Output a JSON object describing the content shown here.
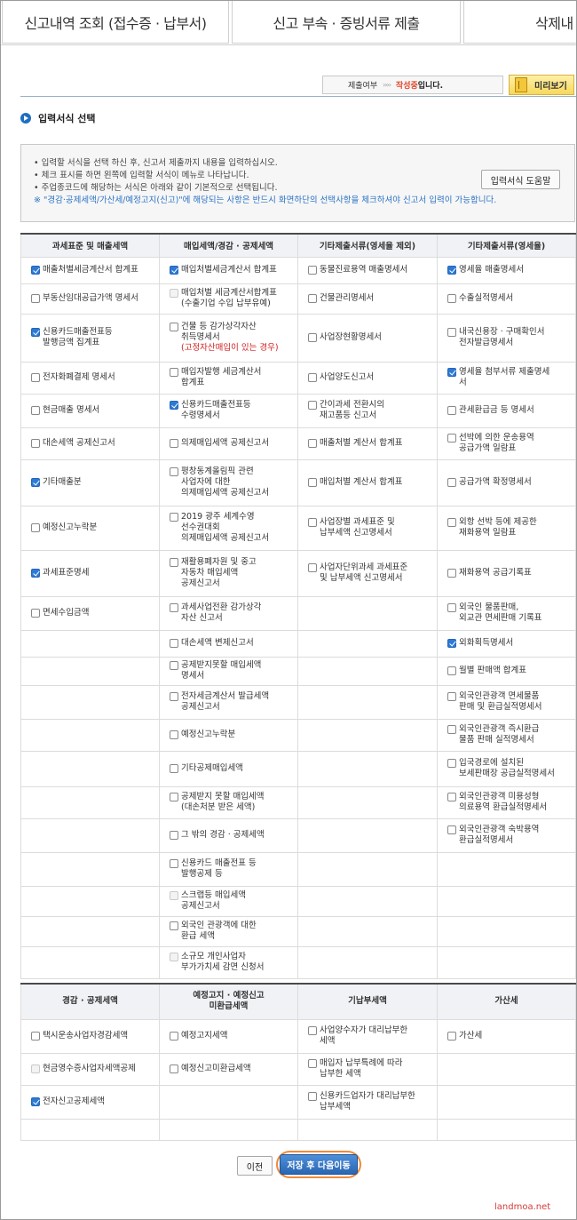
{
  "tabs": [
    {
      "label": "신고내역 조회 (접수증 · 납부서)"
    },
    {
      "label": "신고 부속 · 증빙서류 제출"
    },
    {
      "label": "삭제내"
    }
  ],
  "status_bar": {
    "label": "제출여부",
    "arrows": "››››",
    "state": "작성중",
    "suffix": "입니다.",
    "preview_label": "미리보기"
  },
  "section_title": "입력서식 선택",
  "info": {
    "lines": [
      "• 입력할 서식을 선택 하신 후, 신고서 제출까지 내용을 입력하십시오.",
      "• 체크 표시를 하면 왼쪽에 입력할 서식이 메뉴로 나타납니다.",
      "• 주업종코드에 해당하는 서식은 아래와 같이 기본적으로 선택됩니다."
    ],
    "note": "※ \"경감·공제세액/가산세/예정고지(신고)\"에 해당되는 사항은 반드시 화면하단의 선택사항을 체크하셔야 신고서 입력이 가능합니다.",
    "help_button": "입력서식 도움말"
  },
  "main_table": {
    "headers": [
      "과세표준 및 매출세액",
      "매입세액/경감 · 공제세액",
      "기타제출서류(영세율 제외)",
      "기타제출서류(영세율)"
    ],
    "rows": [
      {
        "h": 30,
        "cells": [
          {
            "lines": [
              "매출처별세금계산서 합계표"
            ],
            "checked": true
          },
          {
            "lines": [
              "매입처별세금계산서 합계표"
            ],
            "checked": true
          },
          {
            "lines": [
              "동물진료용역 매출명세서"
            ],
            "checked": false
          },
          {
            "lines": [
              "영세율 매출명세서"
            ],
            "checked": true
          }
        ]
      },
      {
        "h": 34,
        "cells": [
          {
            "lines": [
              "부동산임대공급가액 명세서"
            ],
            "checked": false
          },
          {
            "lines": [
              "매입처별 세금계산서합계표",
              "(수출기업 수입 납부유예)"
            ],
            "checked": false,
            "disabled": true
          },
          {
            "lines": [
              "건물관리명세서"
            ],
            "checked": false
          },
          {
            "lines": [
              "수출실적명세서"
            ],
            "checked": false
          }
        ]
      },
      {
        "h": 54,
        "cells": [
          {
            "lines": [
              "신용카드매출전표등",
              "발행금액 집계표"
            ],
            "checked": true
          },
          {
            "lines": [
              "건물 등 감가상각자산",
              "취득명세서"
            ],
            "red": "(고정자산매입이 있는 경우)",
            "checked": false
          },
          {
            "lines": [
              "사업장현황명세서"
            ],
            "checked": false
          },
          {
            "lines": [
              "내국신용장 · 구매확인서",
              "전자발급명세서"
            ],
            "checked": false
          }
        ]
      },
      {
        "h": 36,
        "cells": [
          {
            "lines": [
              "전자화폐결제 명세서"
            ],
            "checked": false
          },
          {
            "lines": [
              "매입자발행 세금계산서",
              "합계표"
            ],
            "checked": false
          },
          {
            "lines": [
              "사업양도신고서"
            ],
            "checked": false
          },
          {
            "lines": [
              "영세율 첨부서류 제출명세",
              "서"
            ],
            "checked": true
          }
        ]
      },
      {
        "h": 38,
        "cells": [
          {
            "lines": [
              "현금매출 명세서"
            ],
            "checked": false
          },
          {
            "lines": [
              "신용카드매출전표등",
              "수령명세서"
            ],
            "checked": true
          },
          {
            "lines": [
              "간이과세 전환시의",
              "재고품등 신고서"
            ],
            "checked": false
          },
          {
            "lines": [
              "관세환급금 등 명세서"
            ],
            "checked": false
          }
        ]
      },
      {
        "h": 36,
        "cells": [
          {
            "lines": [
              "대손세액 공제신고서"
            ],
            "checked": false
          },
          {
            "lines": [
              "의제매입세액 공제신고서"
            ],
            "checked": false
          },
          {
            "lines": [
              "매출처별 계산서 합계표"
            ],
            "checked": false
          },
          {
            "lines": [
              "선박에 의한 운송용역",
              "공급가액 일람표"
            ],
            "checked": false
          }
        ]
      },
      {
        "h": 52,
        "cells": [
          {
            "lines": [
              "기타매출분"
            ],
            "checked": true
          },
          {
            "lines": [
              "평창동계올림픽 관련",
              "사업자에 대한",
              "의제매입세액 공제신고서"
            ],
            "checked": false
          },
          {
            "lines": [
              "매입처별 계산서 합계표"
            ],
            "checked": false
          },
          {
            "lines": [
              "공급가액 확정명세서"
            ],
            "checked": false
          }
        ]
      },
      {
        "h": 50,
        "cells": [
          {
            "lines": [
              "예정신고누락분"
            ],
            "checked": false
          },
          {
            "lines": [
              "2019 광주 세계수영",
              "선수권대회",
              "의제매입세액 공제신고서"
            ],
            "checked": false
          },
          {
            "lines": [
              "사업장별 과세표준 및",
              "납부세액 신고명세서"
            ],
            "checked": false
          },
          {
            "lines": [
              "외항 선박 등에 제공한",
              "재화용역 일람표"
            ],
            "checked": false
          }
        ]
      },
      {
        "h": 52,
        "cells": [
          {
            "lines": [
              "과세표준명세"
            ],
            "checked": true
          },
          {
            "lines": [
              "재활용폐자원 및 중고",
              "자동차 매입세액",
              "공제신고서"
            ],
            "checked": false
          },
          {
            "lines": [
              "사업자단위과세 과세표준",
              "및 납부세액 신고명세서"
            ],
            "checked": false
          },
          {
            "lines": [
              "재화용역 공급기록표"
            ],
            "checked": false
          }
        ]
      },
      {
        "h": 38,
        "cells": [
          {
            "lines": [
              "면세수입금액"
            ],
            "checked": false
          },
          {
            "lines": [
              "과세사업전환 감가상각",
              "자산 신고서"
            ],
            "checked": false
          },
          null,
          {
            "lines": [
              "외국인 물품판매,",
              "외교관 면세판매 기록표"
            ],
            "checked": false
          }
        ]
      },
      {
        "h": 30,
        "cells": [
          null,
          {
            "lines": [
              "대손세액 변제신고서"
            ],
            "checked": false
          },
          null,
          {
            "lines": [
              "외화획득명세서"
            ],
            "checked": true
          }
        ]
      },
      {
        "h": 32,
        "cells": [
          null,
          {
            "lines": [
              "공제받지못할 매입세액",
              "명세서"
            ],
            "checked": false
          },
          null,
          {
            "lines": [
              "월별 판매액 합계표"
            ],
            "checked": false
          }
        ]
      },
      {
        "h": 38,
        "cells": [
          null,
          {
            "lines": [
              "전자세금계산서 발급세액",
              "공제신고서"
            ],
            "checked": false
          },
          null,
          {
            "lines": [
              "외국인관광객 면세물품",
              "판매 및 환급실적명세서"
            ],
            "checked": false
          }
        ]
      },
      {
        "h": 36,
        "cells": [
          null,
          {
            "lines": [
              "예정신고누락분"
            ],
            "checked": false
          },
          null,
          {
            "lines": [
              "외국인관광객 즉시환급",
              "물품 판매 실적명세서"
            ],
            "checked": false
          }
        ]
      },
      {
        "h": 40,
        "cells": [
          null,
          {
            "lines": [
              "기타공제매입세액"
            ],
            "checked": false
          },
          null,
          {
            "lines": [
              "입국경로에 설치된",
              "보세판매장 공급실적명세서"
            ],
            "checked": false
          }
        ]
      },
      {
        "h": 36,
        "cells": [
          null,
          {
            "lines": [
              "공제받지 못할 매입세액",
              "(대손처분 받은 세액)"
            ],
            "checked": false
          },
          null,
          {
            "lines": [
              "외국인관광객 미용성형",
              "의료용역 환급실적명세서"
            ],
            "checked": false
          }
        ]
      },
      {
        "h": 38,
        "cells": [
          null,
          {
            "lines": [
              "그 밖의 경감 · 공제세액"
            ],
            "checked": false
          },
          null,
          {
            "lines": [
              "외국인관광객 숙박용역",
              "환급실적명세서"
            ],
            "checked": false
          }
        ]
      },
      {
        "h": 38,
        "cells": [
          null,
          {
            "lines": [
              "신용카드 매출전표 등",
              "발행공제 등"
            ],
            "checked": false
          },
          null,
          null
        ]
      },
      {
        "h": 34,
        "cells": [
          null,
          {
            "lines": [
              "스크랩등 매입세액",
              "공제신고서"
            ],
            "checked": false,
            "disabled": true
          },
          null,
          null
        ]
      },
      {
        "h": 34,
        "cells": [
          null,
          {
            "lines": [
              "외국인 관광객에 대한",
              "환급 세액"
            ],
            "checked": false
          },
          null,
          null
        ]
      },
      {
        "h": 36,
        "cells": [
          null,
          {
            "lines": [
              "소규모 개인사업자",
              "부가가치세 감면 신청서"
            ],
            "checked": false,
            "disabled": true
          },
          null,
          null
        ]
      }
    ]
  },
  "bottom_table": {
    "headers": [
      "경감 · 공제세액",
      "예정고지 · 예정신고\n미환급세액",
      "기납부세액",
      "가산세"
    ],
    "rows": [
      {
        "h": 38,
        "cells": [
          {
            "lines": [
              "택시운송사업자경감세액"
            ],
            "checked": false
          },
          {
            "lines": [
              "예정고지세액"
            ],
            "checked": false
          },
          {
            "lines": [
              "사업양수자가 대리납부한",
              "세액"
            ],
            "checked": false
          },
          {
            "lines": [
              "가산세"
            ],
            "checked": false
          }
        ]
      },
      {
        "h": 36,
        "cells": [
          {
            "lines": [
              "현금영수증사업자세액공제"
            ],
            "checked": false,
            "disabled": true
          },
          {
            "lines": [
              "예정신고미환급세액"
            ],
            "checked": false
          },
          {
            "lines": [
              "매입자 납부특례에 따라",
              "납부한 세액"
            ],
            "checked": false
          },
          null
        ]
      },
      {
        "h": 38,
        "cells": [
          {
            "lines": [
              "전자신고공제세액"
            ],
            "checked": true
          },
          null,
          {
            "lines": [
              "신용카드업자가 대리납부한",
              "납부세액"
            ],
            "checked": false
          },
          null
        ]
      },
      {
        "h": 24,
        "cells": [
          null,
          null,
          null,
          null
        ]
      }
    ]
  },
  "buttons": {
    "prev": "이전",
    "save_next": "저장 후 다음이동"
  },
  "watermark": "landmoa.net",
  "colors": {
    "accent": "#2d7ad6",
    "writing": "#e0462c",
    "note_blue": "#2b73c4",
    "highlight_ring": "#f08a3a"
  }
}
